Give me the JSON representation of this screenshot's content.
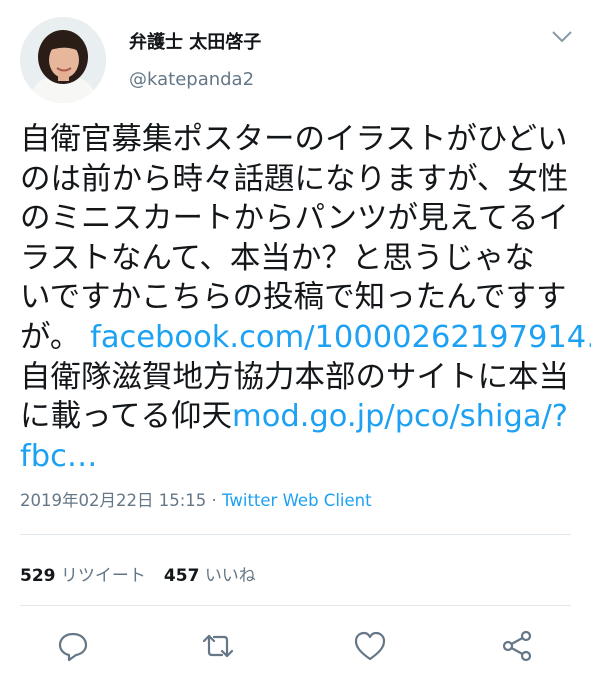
{
  "user": {
    "display_name": "弁護士 太田啓子",
    "handle": "@katepanda2"
  },
  "tweet": {
    "text": {
      "line1": "自衛官募集ポスターのイラストがひどい",
      "line2": "のは前から時々話題になりますが、女性",
      "line3": "のミニスカートからパンツが見えてるイ",
      "line4": "ラストなんて、本当か？と思うじゃな",
      "line5": "いですかこちらの投稿で知ったんですす",
      "line6_prefix": "が。",
      "link1": "facebook.com/10000262197914…",
      "line7": "自衛隊滋賀地方協力本部のサイトに本当",
      "line8_prefix": "に載ってる仰天",
      "link2_part1": "mod.go.jp/pco/shiga/?",
      "link2_part2": "fbc…"
    },
    "timestamp": "2019年02月22日 15:15",
    "separator": " · ",
    "client": "Twitter Web Client"
  },
  "stats": {
    "retweet_count": "529",
    "retweet_label": "リツイート",
    "like_count": "457",
    "like_label": "いいね"
  },
  "icons": {
    "menu": "chevron-down-icon",
    "reply": "reply-icon",
    "retweet": "retweet-icon",
    "like": "heart-icon",
    "share": "share-icon"
  },
  "colors": {
    "text": "#14171a",
    "secondary": "#657786",
    "link": "#1da1f2",
    "divider": "#e1e8ed",
    "icon": "#657786"
  }
}
